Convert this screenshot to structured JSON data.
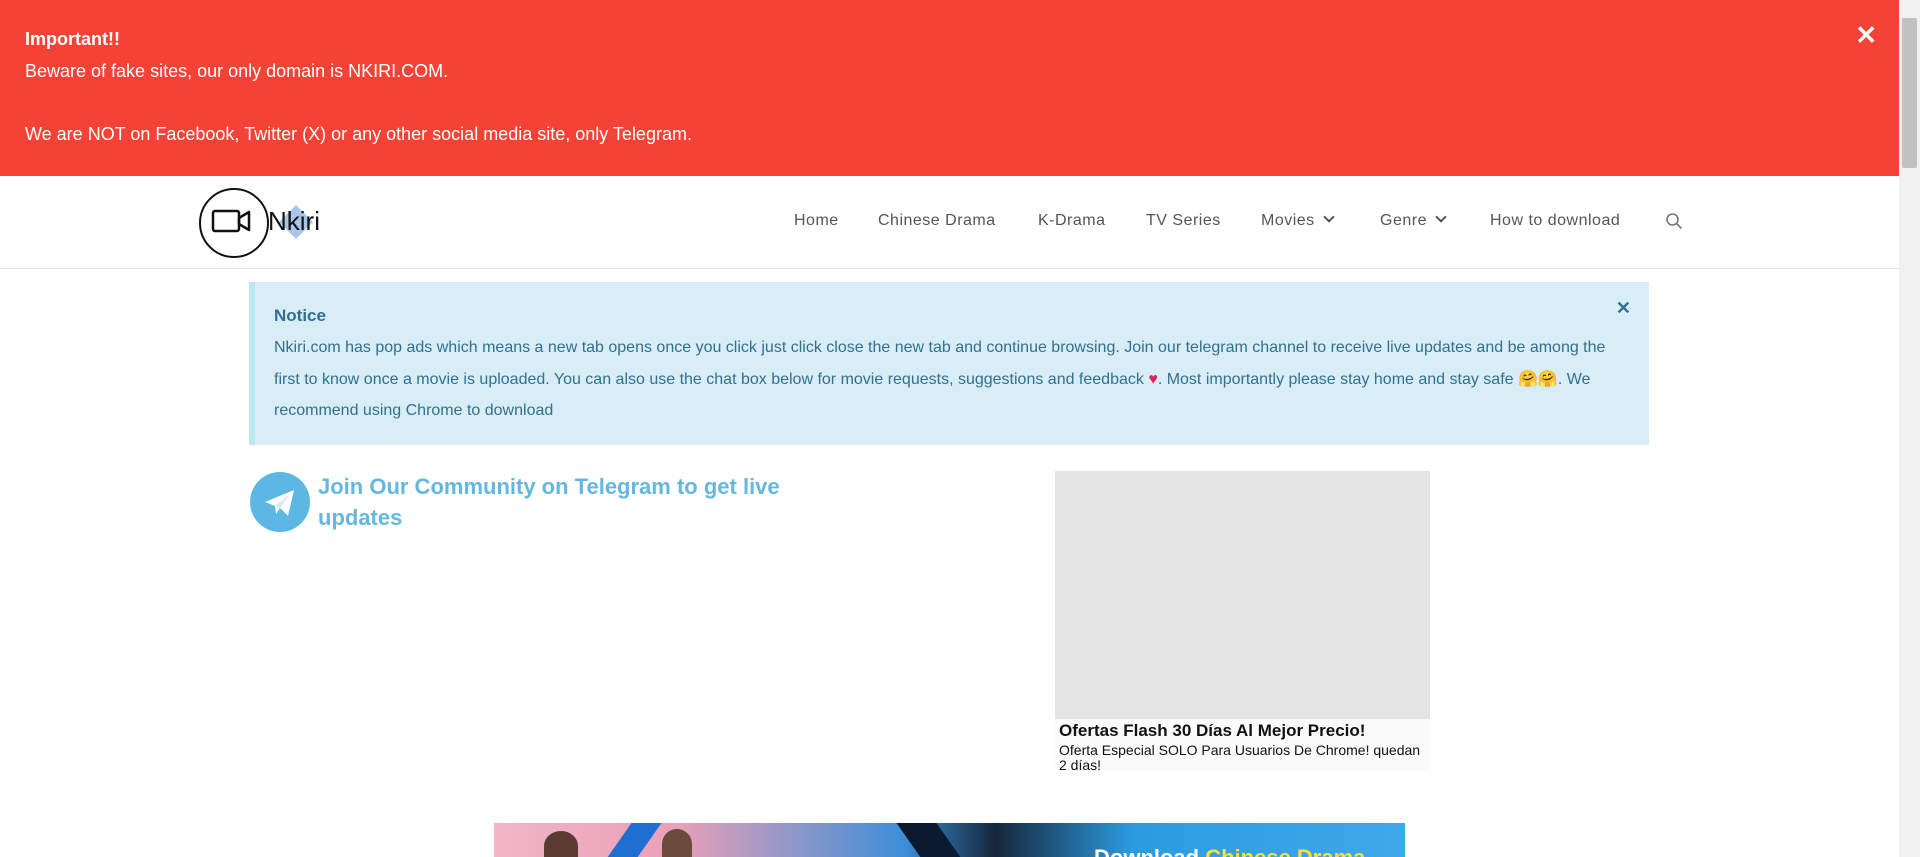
{
  "alert": {
    "title": "Important!!",
    "line1": "Beware of fake sites, our only domain is NKIRI.COM.",
    "line2": "We are NOT on Facebook, Twitter (X) or any other social media site, only Telegram.",
    "close_symbol": "✕",
    "background_color": "#f44336"
  },
  "logo": {
    "text": "Nkiri"
  },
  "nav": {
    "items": [
      {
        "label": "Home"
      },
      {
        "label": "Chinese Drama"
      },
      {
        "label": "K-Drama"
      },
      {
        "label": "TV Series"
      },
      {
        "label": "Movies",
        "has_dropdown": true
      },
      {
        "label": "Genre",
        "has_dropdown": true
      },
      {
        "label": "How to download"
      }
    ],
    "search_icon": "search-icon"
  },
  "notice": {
    "title": "Notice",
    "text_part1": "Nkiri.com has pop ads which means a new tab opens once you click just click close the new tab and continue browsing. Join our telegram channel to receive live updates and be among the first to know once a movie is uploaded. You can also use the chat box below for movie requests, suggestions and feedback ",
    "heart": "♥",
    "text_part2": ". Most importantly please stay home and stay safe ",
    "emoji": "🤗🤗",
    "text_part3": ". We recommend using Chrome to download",
    "close_symbol": "✕",
    "background_color": "#d9edf7",
    "text_color": "#31708f"
  },
  "telegram": {
    "text": "Join Our Community on Telegram to get live updates",
    "icon": "telegram-icon",
    "color": "#64b8e0"
  },
  "ad": {
    "title": "Ofertas Flash 30 Días Al Mejor Precio!",
    "description": "Oferta Especial SOLO Para Usuarios De Chrome! quedan 2 días!"
  },
  "banner": {
    "text_before": "Download ",
    "text_highlight": "Chinese Drama"
  }
}
